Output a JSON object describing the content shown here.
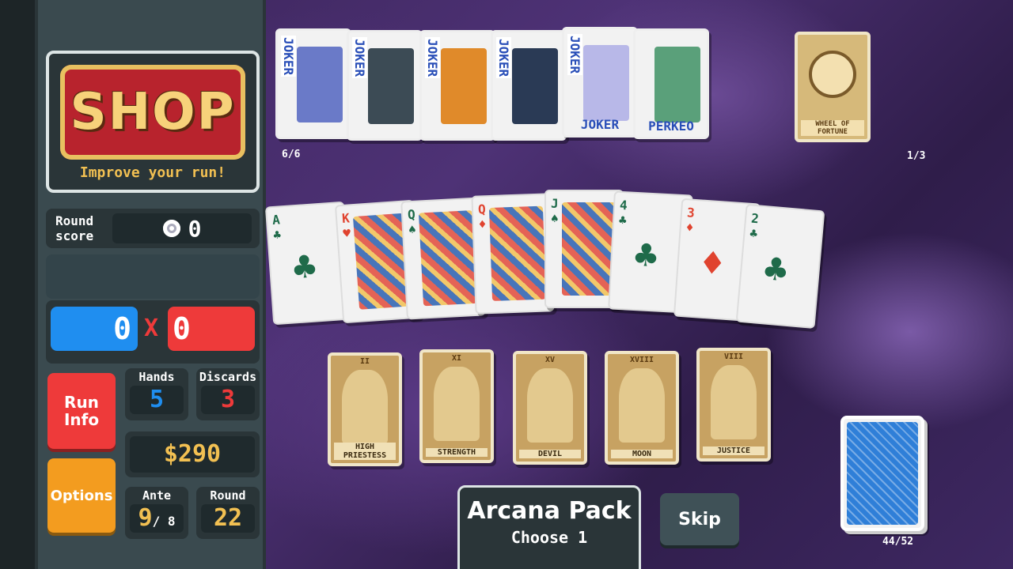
{
  "sidebar": {
    "shop_title": "SHOP",
    "shop_subtitle": "Improve your run!",
    "round_score_label_1": "Round",
    "round_score_label_2": "score",
    "round_score_value": "0",
    "chips": "0",
    "mult": "0",
    "times": "X",
    "run_info_1": "Run",
    "run_info_2": "Info",
    "options": "Options",
    "hands_label": "Hands",
    "hands_value": "5",
    "discards_label": "Discards",
    "discards_value": "3",
    "money": "$290",
    "ante_label": "Ante",
    "ante_value": "9",
    "ante_max": "/ 8",
    "round_label": "Round",
    "round_value": "22"
  },
  "jokers": {
    "count": "6/6",
    "items": [
      {
        "label": "JOKER",
        "color": "#6a7ac8"
      },
      {
        "label": "JOKER",
        "color": "#3c4b55"
      },
      {
        "label": "JOKER",
        "color": "#e08a2a"
      },
      {
        "label": "JOKER",
        "color": "#2a3a55"
      },
      {
        "label": "JOKER",
        "color": "#b8b8e8",
        "bottom": "JOKER"
      },
      {
        "label": "",
        "color": "#5aa07a",
        "bottom": "PERKEO"
      }
    ]
  },
  "consumables": {
    "count": "1/3",
    "card_name": "WHEEL OF FORTUNE"
  },
  "hand_cards": [
    {
      "rank": "A",
      "suit": "♣",
      "suit_class": "clubs",
      "face": false
    },
    {
      "rank": "K",
      "suit": "♥",
      "suit_class": "hearts",
      "face": true
    },
    {
      "rank": "Q",
      "suit": "♠",
      "suit_class": "spades",
      "face": true
    },
    {
      "rank": "Q",
      "suit": "♦",
      "suit_class": "diamonds",
      "face": true
    },
    {
      "rank": "J",
      "suit": "♠",
      "suit_class": "spades",
      "face": true
    },
    {
      "rank": "4",
      "suit": "♣",
      "suit_class": "clubs",
      "face": false
    },
    {
      "rank": "3",
      "suit": "♦",
      "suit_class": "diamonds",
      "face": false
    },
    {
      "rank": "2",
      "suit": "♣",
      "suit_class": "clubs",
      "face": false
    }
  ],
  "pack_cards": [
    {
      "numeral": "II",
      "name": "HIGH PRIESTESS"
    },
    {
      "numeral": "XI",
      "name": "STRENGTH"
    },
    {
      "numeral": "XV",
      "name": "DEVIL"
    },
    {
      "numeral": "XVIII",
      "name": "MOON"
    },
    {
      "numeral": "VIII",
      "name": "JUSTICE"
    }
  ],
  "pack": {
    "title": "Arcana Pack",
    "subtitle": "Choose 1",
    "skip": "Skip"
  },
  "deck": {
    "count": "44/52"
  }
}
